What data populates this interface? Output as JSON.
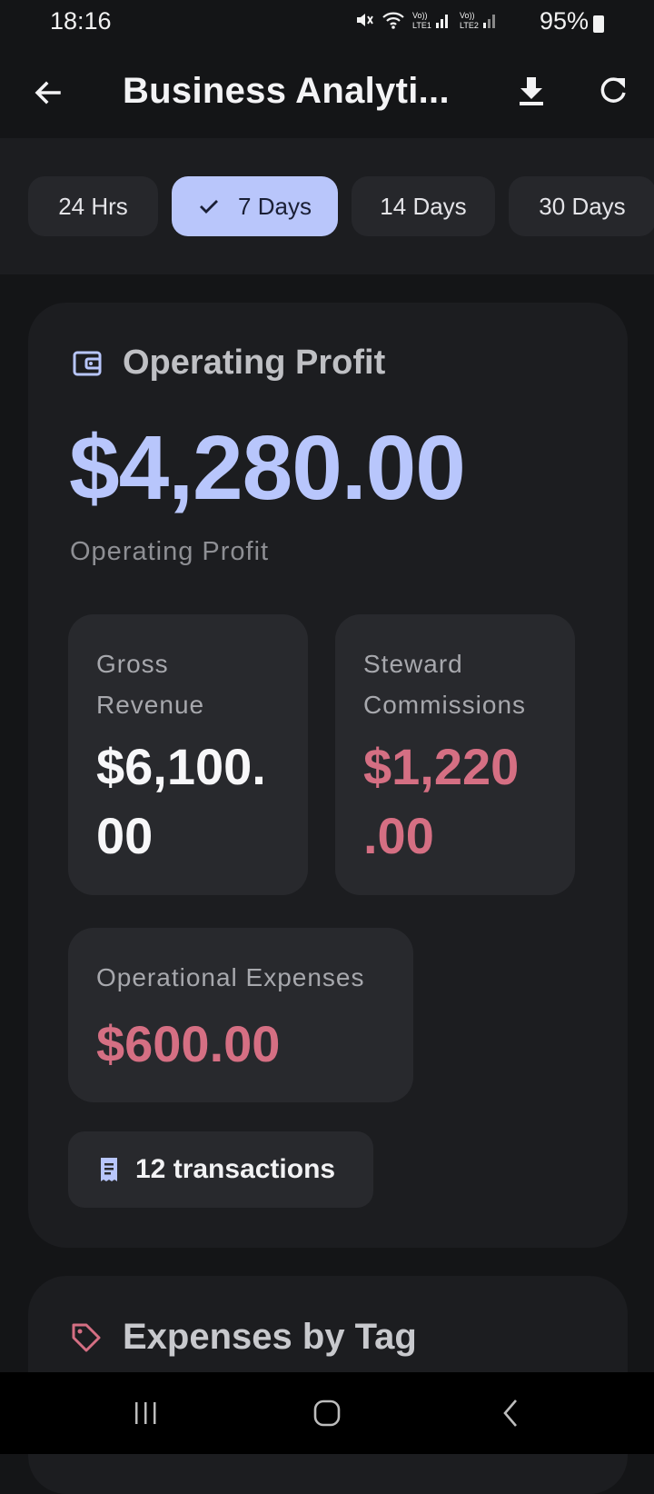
{
  "status_bar": {
    "time": "18:16",
    "battery": "95%",
    "icons": [
      "mute-icon",
      "wifi-icon",
      "lte1-signal-icon",
      "lte2-signal-icon",
      "battery-icon"
    ]
  },
  "app_bar": {
    "title": "Business Analyti...",
    "back_icon": "arrow-left-icon",
    "download_icon": "download-icon",
    "refresh_icon": "refresh-icon"
  },
  "filters": {
    "chips": [
      {
        "label": "24 Hrs",
        "selected": false
      },
      {
        "label": "7 Days",
        "selected": true
      },
      {
        "label": "14 Days",
        "selected": false
      },
      {
        "label": "30 Days",
        "selected": false
      }
    ]
  },
  "profit_card": {
    "title": "Operating Profit",
    "amount": "$4,280.00",
    "caption": "Operating Profit",
    "gross_revenue": {
      "label_line1": "Gross",
      "label_line2": "Revenue",
      "value_line1": "$6,100.",
      "value_line2": "00"
    },
    "steward_commissions": {
      "label_line1": "Steward",
      "label_line2": "Commissions",
      "value_line1": "$1,220",
      "value_line2": ".00"
    },
    "operational_expenses": {
      "label": "Operational Expenses",
      "value": "$600.00"
    },
    "transactions": "12 transactions"
  },
  "expenses_card": {
    "title": "Expenses by Tag"
  },
  "colors": {
    "accent": "#b9c6fb",
    "negative": "#d56f83",
    "background": "#141517",
    "card": "#1c1d20"
  }
}
